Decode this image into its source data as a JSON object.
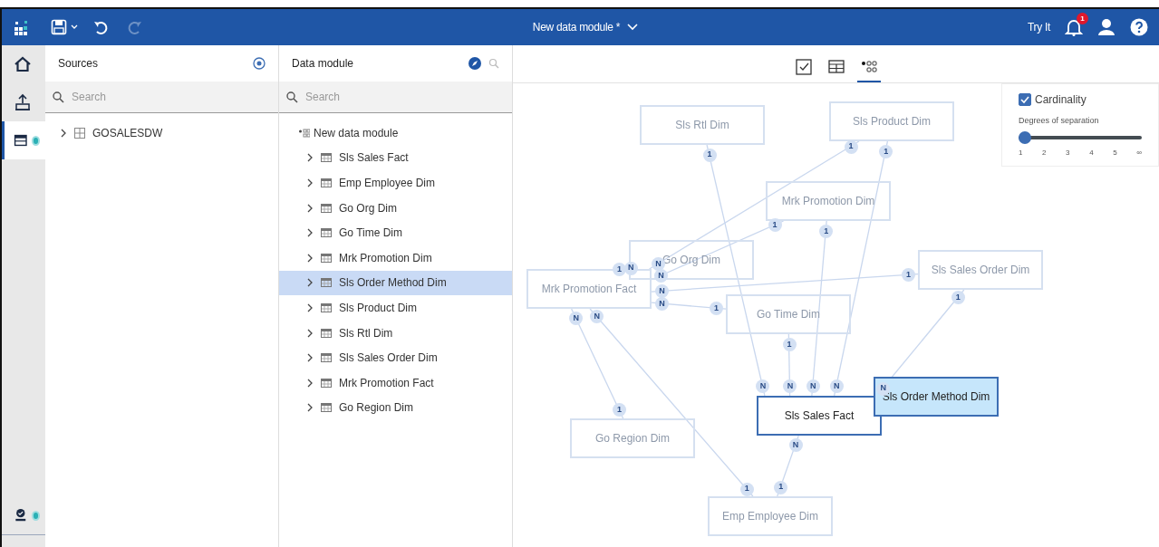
{
  "top_bar": {
    "title": "New data module *",
    "try_it": "Try It",
    "notifications": "1",
    "redo_disabled": true
  },
  "rail": [
    {
      "kind": "home",
      "selected": false,
      "dot": false
    },
    {
      "kind": "upload",
      "selected": false,
      "dot": false
    },
    {
      "kind": "module",
      "selected": true,
      "dot": true
    },
    {
      "kind": "validate",
      "selected": false,
      "dot": true
    }
  ],
  "sources": {
    "title": "Sources",
    "search": {
      "placeholder": "Search"
    },
    "items": [
      {
        "label": "GOSALESDW",
        "selected": false
      }
    ]
  },
  "data_module": {
    "title": "Data module",
    "search": {
      "placeholder": "Search"
    },
    "root": "New data module",
    "items": [
      {
        "label": "Sls Sales Fact",
        "selected": false
      },
      {
        "label": "Emp Employee Dim",
        "selected": false
      },
      {
        "label": "Go Org Dim",
        "selected": false
      },
      {
        "label": "Go Time Dim",
        "selected": false
      },
      {
        "label": "Mrk Promotion Dim",
        "selected": false
      },
      {
        "label": "Sls Order Method Dim",
        "selected": true
      },
      {
        "label": "Sls Product Dim",
        "selected": false
      },
      {
        "label": "Sls Rtl Dim",
        "selected": false
      },
      {
        "label": "Sls Sales Order Dim",
        "selected": false
      },
      {
        "label": "Mrk Promotion Fact",
        "selected": false
      },
      {
        "label": "Go Region Dim",
        "selected": false
      }
    ]
  },
  "view_tabs": [
    {
      "kind": "validate",
      "selected": false
    },
    {
      "kind": "grid",
      "selected": false
    },
    {
      "kind": "relationships",
      "selected": true
    }
  ],
  "cardinality_panel": {
    "label": "Cardinality",
    "checked": true,
    "slider_label": "Degrees of separation",
    "slider": {
      "level": 0
    },
    "ticks": [
      "1",
      "2",
      "3",
      "4",
      "5",
      "∞"
    ]
  },
  "diagram": {
    "nodes": [
      {
        "label": "Sls Rtl Dim",
        "focused": false,
        "selected": false
      },
      {
        "label": "Sls Product Dim",
        "focused": false,
        "selected": false
      },
      {
        "label": "Mrk Promotion Dim",
        "focused": false,
        "selected": false
      },
      {
        "label": "Go Org Dim",
        "focused": false,
        "selected": false
      },
      {
        "label": "Sls Sales Order Dim",
        "focused": false,
        "selected": false
      },
      {
        "label": "Mrk Promotion Fact",
        "focused": false,
        "selected": false
      },
      {
        "label": "Go Time Dim",
        "focused": false,
        "selected": false
      },
      {
        "label": "Sls Sales Fact",
        "focused": true,
        "selected": false
      },
      {
        "label": "Sls Order Method Dim",
        "focused": false,
        "selected": true
      },
      {
        "label": "Go Region Dim",
        "focused": false,
        "selected": false
      },
      {
        "label": "Emp Employee Dim",
        "focused": false,
        "selected": false
      }
    ],
    "edges": [
      {
        "ends": [
          "N",
          "1"
        ]
      },
      {
        "ends": [
          "N",
          "1"
        ]
      },
      {
        "ends": [
          "1",
          "N"
        ]
      },
      {
        "ends": [
          "1",
          "N"
        ]
      },
      {
        "ends": [
          "1",
          "N"
        ]
      },
      {
        "ends": [
          "1",
          "N"
        ]
      },
      {
        "ends": [
          "N",
          "1"
        ]
      },
      {
        "ends": [
          "1",
          "N"
        ]
      },
      {
        "ends": [
          "1",
          "N"
        ]
      },
      {
        "ends": [
          "1",
          "N"
        ]
      },
      {
        "ends": [
          "1",
          "N"
        ]
      },
      {
        "ends": [
          "1",
          "N"
        ]
      },
      {
        "ends": [
          "N",
          "1"
        ]
      }
    ]
  }
}
